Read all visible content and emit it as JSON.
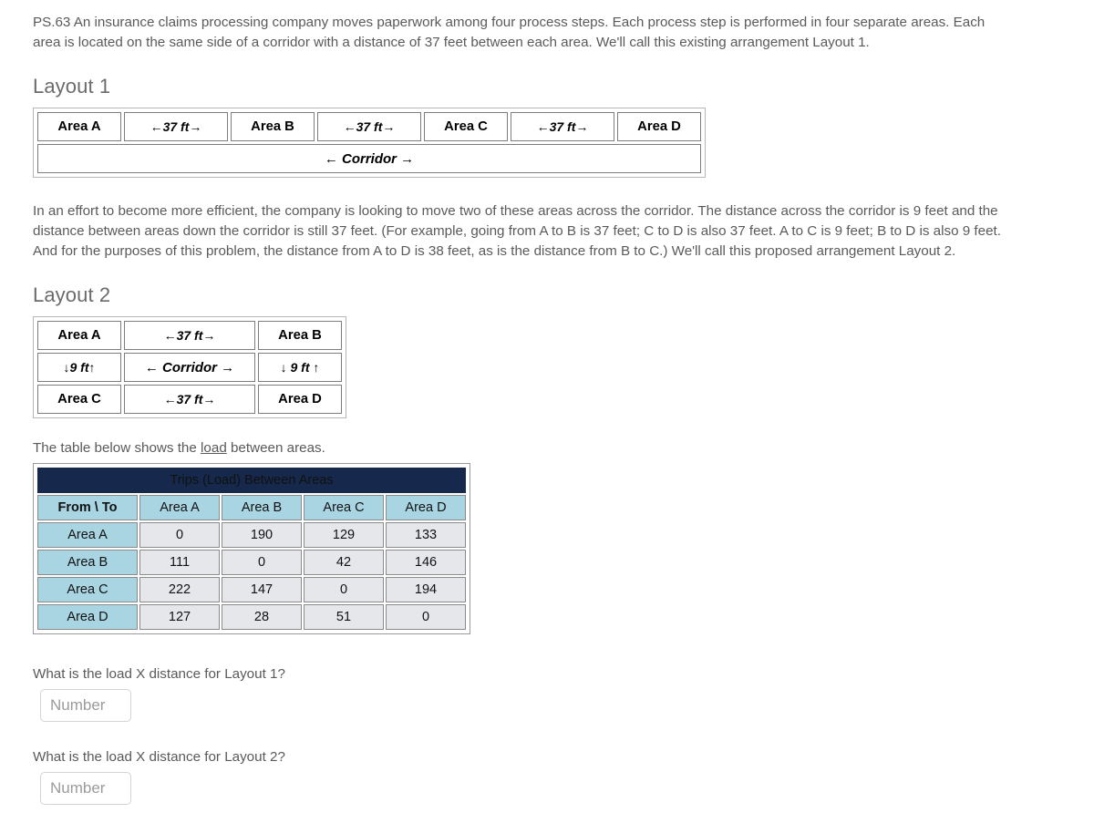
{
  "intro": {
    "paragraph1": "PS.63 An insurance claims processing company moves paperwork among four process steps. Each process step is performed in four separate areas. Each area is located on the same side of a corridor with a distance of 37 feet between each area. We'll call this existing arrangement Layout 1.",
    "paragraph2": "In an effort to become more efficient, the company is looking to move two of these areas across the corridor. The distance across the corridor is 9 feet and the distance between areas down the corridor is still 37 feet. (For example, going from A to B is 37 feet; C to D is also 37 feet. A to C is 9 feet; B to D is also 9 feet. And for the purposes of this problem, the distance from A to D is 38 feet, as is the distance from B to C.) We'll call this proposed arrangement Layout 2."
  },
  "layout1": {
    "heading": "Layout 1",
    "cells": [
      {
        "label": "Area A",
        "kind": "area",
        "color": "#e0696c"
      },
      {
        "label": "←37 ft→",
        "kind": "dist",
        "color": "#ffffff"
      },
      {
        "label": "Area B",
        "kind": "area",
        "color": "#f8a500"
      },
      {
        "label": "←37 ft→",
        "kind": "dist",
        "color": "#ffffff"
      },
      {
        "label": "Area C",
        "kind": "area",
        "color": "#69a34b"
      },
      {
        "label": "←37 ft→",
        "kind": "dist",
        "color": "#ffffff"
      },
      {
        "label": "Area D",
        "kind": "area",
        "color": "#c0900a"
      }
    ],
    "corridor": "← Corridor →"
  },
  "layout2": {
    "heading": "Layout 2",
    "rows": [
      [
        {
          "label": "Area A",
          "kind": "area",
          "color": "#e0696c"
        },
        {
          "label": "←37 ft→",
          "kind": "dist",
          "color": "#ffffff"
        },
        {
          "label": "Area B",
          "kind": "area",
          "color": "#f8a500"
        }
      ],
      [
        {
          "label": "↓9 ft↑",
          "kind": "dist",
          "color": "#ffffff"
        },
        {
          "label": "← Corridor →",
          "kind": "corr",
          "color": "#ffffff"
        },
        {
          "label": "↓ 9 ft ↑",
          "kind": "dist",
          "color": "#ffffff"
        }
      ],
      [
        {
          "label": "Area C",
          "kind": "area",
          "color": "#69a34b"
        },
        {
          "label": "←37 ft→",
          "kind": "dist",
          "color": "#ffffff"
        },
        {
          "label": "Area D",
          "kind": "area",
          "color": "#c0900a"
        }
      ]
    ]
  },
  "note": {
    "before": "The table below shows the ",
    "link": "load",
    "after": " between areas."
  },
  "chart_data": {
    "type": "table",
    "title": "Trips (Load) Between Areas",
    "corner_label": "From \\ To",
    "categories": [
      "Area A",
      "Area B",
      "Area C",
      "Area D"
    ],
    "row_labels": [
      "Area A",
      "Area B",
      "Area C",
      "Area D"
    ],
    "values": [
      [
        0,
        190,
        129,
        133
      ],
      [
        111,
        0,
        42,
        146
      ],
      [
        222,
        147,
        0,
        194
      ],
      [
        127,
        28,
        51,
        0
      ]
    ],
    "series": [
      {
        "name": "Area A",
        "values": [
          0,
          190,
          129,
          133
        ]
      },
      {
        "name": "Area B",
        "values": [
          111,
          0,
          42,
          146
        ]
      },
      {
        "name": "Area C",
        "values": [
          222,
          147,
          0,
          194
        ]
      },
      {
        "name": "Area D",
        "values": [
          127,
          28,
          51,
          0
        ]
      }
    ],
    "xlabel": "To",
    "ylabel": "From",
    "colors": {
      "title_bg": "#16284b",
      "header_bg": "#a9d5e3",
      "cell_bg": "#e5e7ea"
    }
  },
  "questions": [
    {
      "label": "What is the load X distance for Layout 1?",
      "placeholder": "Number",
      "value": ""
    },
    {
      "label": "What is the load X distance for Layout 2?",
      "placeholder": "Number",
      "value": ""
    }
  ]
}
